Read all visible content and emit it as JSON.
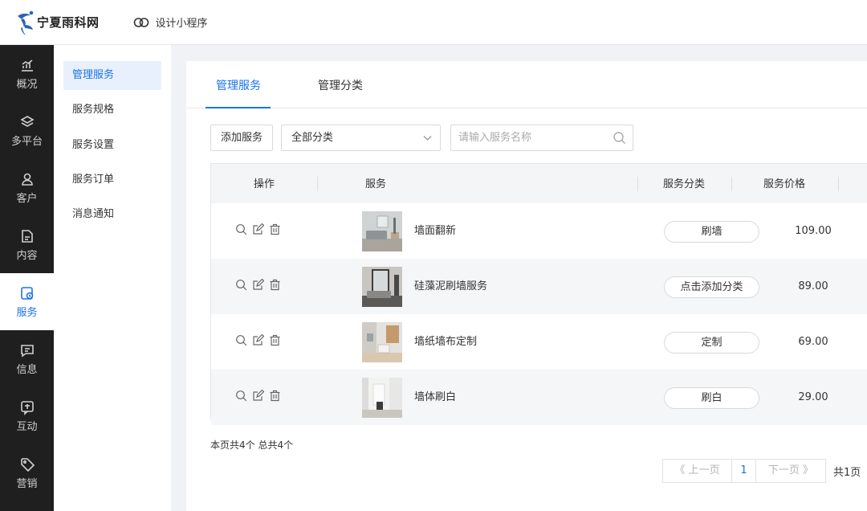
{
  "brand": {
    "logo_text": "宁夏雨科网"
  },
  "header": {
    "miniapp_label": "设计小程序"
  },
  "nav": {
    "items": [
      {
        "label": "概况",
        "icon": "chart-icon"
      },
      {
        "label": "多平台",
        "icon": "layers-icon"
      },
      {
        "label": "客户",
        "icon": "user-icon"
      },
      {
        "label": "内容",
        "icon": "document-icon"
      },
      {
        "label": "服务",
        "icon": "service-icon",
        "active": true
      },
      {
        "label": "信息",
        "icon": "message-icon"
      },
      {
        "label": "互动",
        "icon": "interaction-icon"
      },
      {
        "label": "营销",
        "icon": "tag-icon"
      }
    ]
  },
  "subnav": {
    "items": [
      {
        "label": "管理服务",
        "active": true
      },
      {
        "label": "服务规格"
      },
      {
        "label": "服务设置"
      },
      {
        "label": "服务订单"
      },
      {
        "label": "消息通知"
      }
    ]
  },
  "tabs": [
    {
      "label": "管理服务",
      "active": true
    },
    {
      "label": "管理分类"
    }
  ],
  "toolbar": {
    "add_label": "添加服务",
    "category_select": "全部分类",
    "search_placeholder": "请输入服务名称"
  },
  "table": {
    "headers": {
      "ops": "操作",
      "service": "服务",
      "category": "服务分类",
      "price": "服务价格"
    },
    "rows": [
      {
        "name": "墙面翻新",
        "category": "刷墙",
        "price": "109.00"
      },
      {
        "name": "硅藻泥刷墙服务",
        "category": "点击添加分类",
        "price": "89.00"
      },
      {
        "name": "墙纸墙布定制",
        "category": "定制",
        "price": "69.00"
      },
      {
        "name": "墙体刷白",
        "category": "刷白",
        "price": "29.00"
      }
    ]
  },
  "summary": "本页共4个  总共4个",
  "pagination": {
    "prev": "《 上一页",
    "current": "1",
    "next": "下一页 》",
    "total": "共1页"
  },
  "colors": {
    "accent": "#1a73e8",
    "sidebar_bg": "#1f1f1f",
    "page_bg": "#f0f2f5"
  }
}
